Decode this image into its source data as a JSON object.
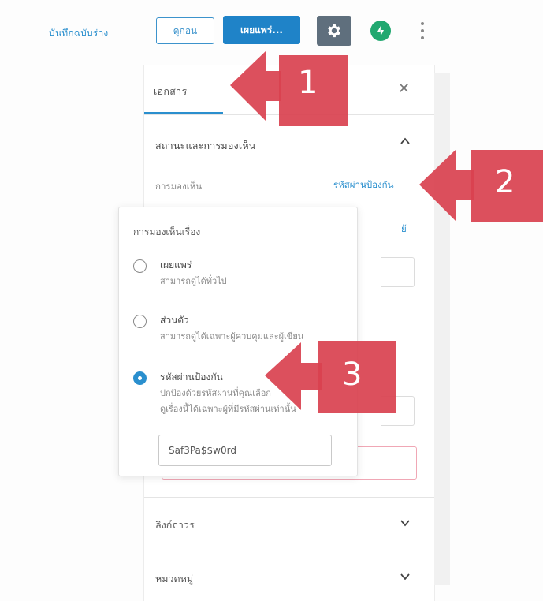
{
  "toolbar": {
    "save_draft": "บันทึกฉบับร่าง",
    "preview": "ดูก่อน",
    "publish": "เผยแพร่...",
    "settings_icon": "gear-icon",
    "jetpack_icon": "jetpack-bolt-icon",
    "more_icon": "vertical-ellipsis-icon"
  },
  "sidebar": {
    "tab": "เอกสาร",
    "close_icon": "close-icon",
    "section_title": "สถานะและการมองเห็น",
    "visibility_label": "การมองเห็น",
    "visibility_value": "รหัสผ่านป้องกัน",
    "partial_link": "ย้",
    "sections": [
      "ลิงก์ถาวร",
      "หมวดหมู่"
    ]
  },
  "popover": {
    "title": "การมองเห็นเรื่อง",
    "options": [
      {
        "label": "เผยแพร่",
        "desc": "สามารถดูได้ทั่วไป",
        "checked": false
      },
      {
        "label": "ส่วนตัว",
        "desc": "สามารถดูได้เฉพาะผู้ควบคุมและผู้เขียน",
        "checked": false
      },
      {
        "label": "รหัสผ่านป้องกัน",
        "desc_line1": "ปกป้องด้วยรหัสผ่านที่คุณเลือก",
        "desc_line2": "ดูเรื่องนี้ได้เฉพาะผู้ที่มีรหัสผ่านเท่านั้น",
        "checked": true
      }
    ],
    "password_value": "Saf3Pa$$w0rd"
  },
  "callouts": [
    "1",
    "2",
    "3"
  ],
  "colors": {
    "accent": "#2a8fce",
    "publish": "#1f83c8",
    "callout": "#d9414f",
    "jetpack": "#21a870",
    "settings": "#5f6f7d"
  }
}
